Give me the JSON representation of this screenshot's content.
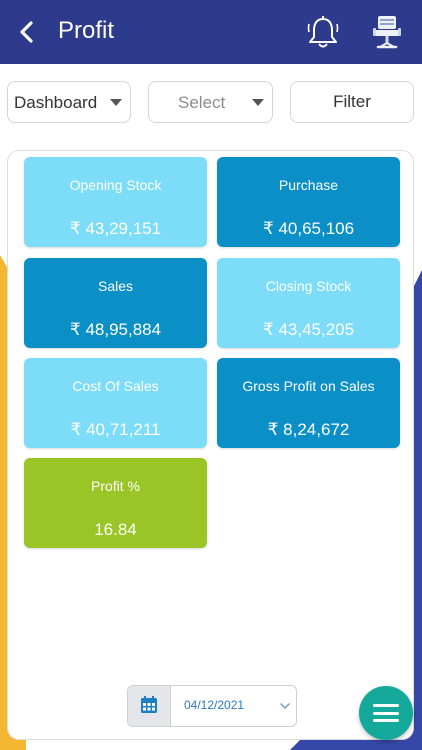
{
  "header": {
    "title": "Profit",
    "back_icon": "chevron-left-icon",
    "notification_icon": "bell-icon",
    "profile_icon": "office-chair-icon",
    "background_color": "#2e3a8c"
  },
  "filters": {
    "dashboard_dropdown": {
      "selected": "Dashboard"
    },
    "secondary_dropdown": {
      "placeholder": "Select"
    },
    "filter_button": "Filter"
  },
  "cards": [
    {
      "label": "Opening Stock",
      "value": "₹ 43,29,151",
      "color": "#7ddcf8"
    },
    {
      "label": "Purchase",
      "value": "₹ 40,65,106",
      "color": "#0b8fc7"
    },
    {
      "label": "Sales",
      "value": "₹ 48,95,884",
      "color": "#0b8fc7"
    },
    {
      "label": "Closing Stock",
      "value": "₹ 43,45,205",
      "color": "#7ddcf8"
    },
    {
      "label": "Cost Of Sales",
      "value": "₹ 40,71,211",
      "color": "#7ddcf8"
    },
    {
      "label": "Gross Profit on Sales",
      "value": "₹ 8,24,672",
      "color": "#0b8fc7"
    },
    {
      "label": "Profit %",
      "value": "16.84",
      "color": "#99c626"
    }
  ],
  "date_picker": {
    "value": "04/12/2021",
    "icon": "calendar-icon"
  },
  "fab": {
    "icon": "menu-icon",
    "color": "#14a99a"
  }
}
